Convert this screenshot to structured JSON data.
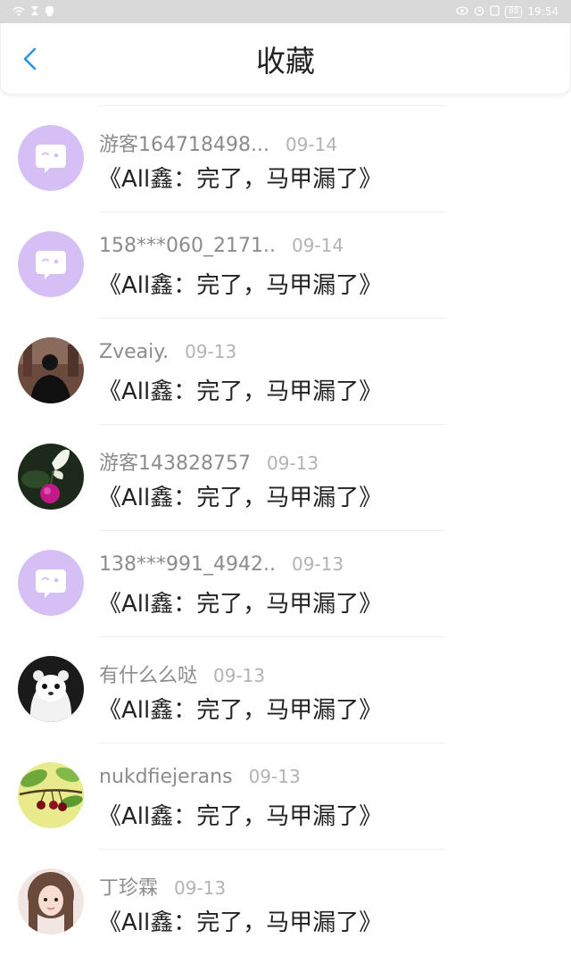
{
  "status_bar": {
    "time": "19:54",
    "battery": "88"
  },
  "header": {
    "title": "收藏"
  },
  "items": [
    {
      "name": "游客164718498...",
      "date": "09-14",
      "title": "《All鑫：完了，马甲漏了》",
      "avatar": "default-avatar"
    },
    {
      "name": "158***060_2171..",
      "date": "09-14",
      "title": "《All鑫：完了，马甲漏了》",
      "avatar": "default-avatar"
    },
    {
      "name": "Zveaiy.",
      "date": "09-13",
      "title": "《All鑫：完了，马甲漏了》",
      "avatar": "silhouette-photo"
    },
    {
      "name": "游客143828757",
      "date": "09-13",
      "title": "《All鑫：完了，马甲漏了》",
      "avatar": "butterfly-flower-photo"
    },
    {
      "name": "138***991_4942..",
      "date": "09-13",
      "title": "《All鑫：完了，马甲漏了》",
      "avatar": "default-avatar"
    },
    {
      "name": "有什么么哒",
      "date": "09-13",
      "title": "《All鑫：完了，马甲漏了》",
      "avatar": "ferret-photo"
    },
    {
      "name": "nukdfiejerans",
      "date": "09-13",
      "title": "《All鑫：完了，马甲漏了》",
      "avatar": "cherries-photo"
    },
    {
      "name": "丁珍霖",
      "date": "09-13",
      "title": "《All鑫：完了，马甲漏了》",
      "avatar": "girl-photo"
    }
  ],
  "colors": {
    "accent": "#2196f3",
    "default_avatar": "#d5bff5"
  }
}
